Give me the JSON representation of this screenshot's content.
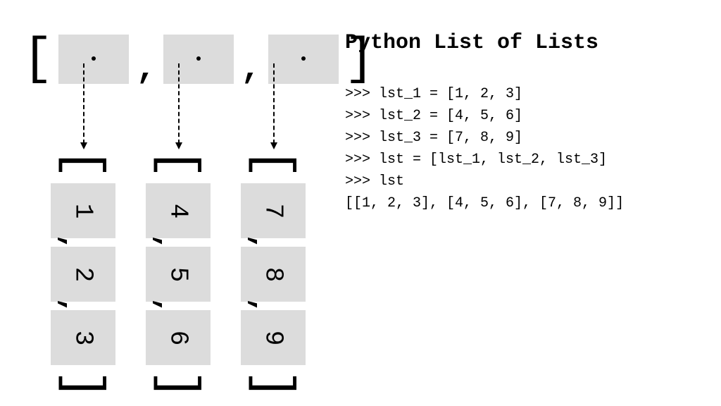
{
  "title": "Python List of Lists",
  "outer": {
    "boxes": 3
  },
  "sublists": [
    {
      "values": [
        "1",
        "2",
        "3"
      ]
    },
    {
      "values": [
        "4",
        "5",
        "6"
      ]
    },
    {
      "values": [
        "7",
        "8",
        "9"
      ]
    }
  ],
  "code": {
    "line1": ">>> lst_1 = [1, 2, 3]",
    "line2": ">>> lst_2 = [4, 5, 6]",
    "line3": ">>> lst_3 = [7, 8, 9]",
    "line4": ">>> lst = [lst_1, lst_2, lst_3]",
    "line5": ">>> lst",
    "line6": "[[1, 2, 3], [4, 5, 6], [7, 8, 9]]"
  },
  "glyphs": {
    "open": "[",
    "close": "]",
    "comma": ","
  }
}
